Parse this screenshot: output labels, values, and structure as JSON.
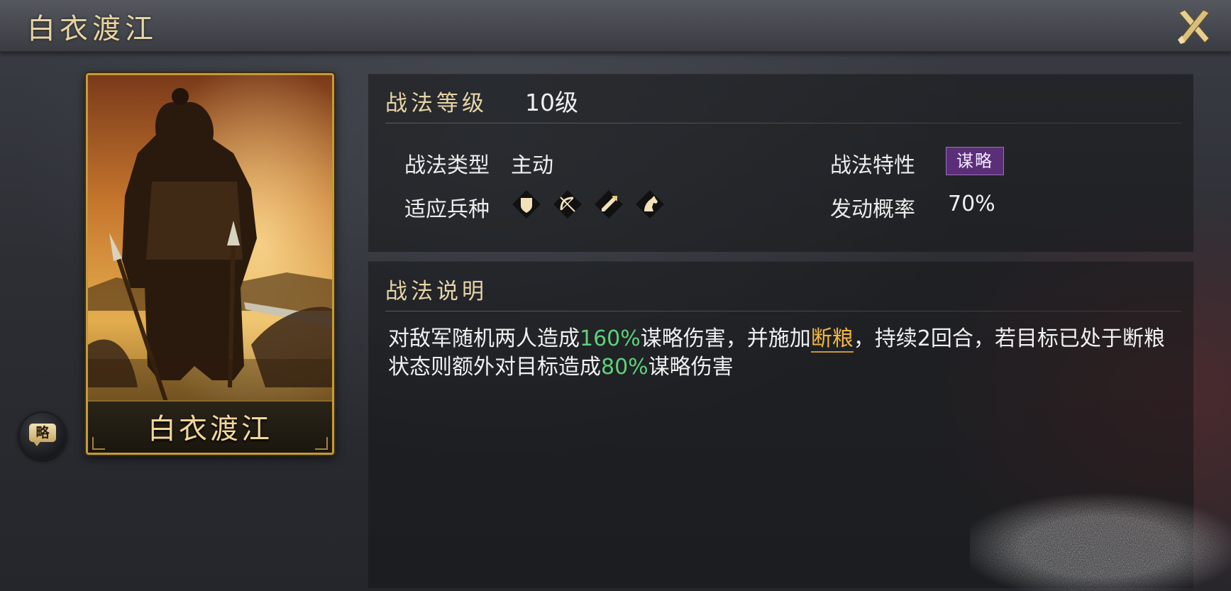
{
  "header": {
    "title": "白衣渡江"
  },
  "card": {
    "name": "白衣渡江",
    "category_badge": "略"
  },
  "info": {
    "level_label": "战法等级",
    "level_value": "10级",
    "type_label": "战法类型",
    "type_value": "主动",
    "trait_label": "战法特性",
    "trait_value": "谋略",
    "units_label": "适应兵种",
    "units": [
      "shield-icon",
      "bow-icon",
      "spear-icon",
      "horse-icon"
    ],
    "rate_label": "发动概率",
    "rate_value": "70%"
  },
  "description": {
    "title": "战法说明",
    "seg1": "对敌军随机两人造成",
    "pct1": "160%",
    "seg2": "谋略伤害，并施加",
    "keyword": "断粮",
    "seg3": "，持续2回合，若目标已处于断粮状态则额外对目标造成",
    "pct2": "80%",
    "seg4": "谋略伤害"
  },
  "colors": {
    "accent_gold": "#e6d4a6",
    "highlight_green": "#5fd07a",
    "keyword_orange": "#f2b642",
    "trait_purple": "#5b2f78"
  }
}
